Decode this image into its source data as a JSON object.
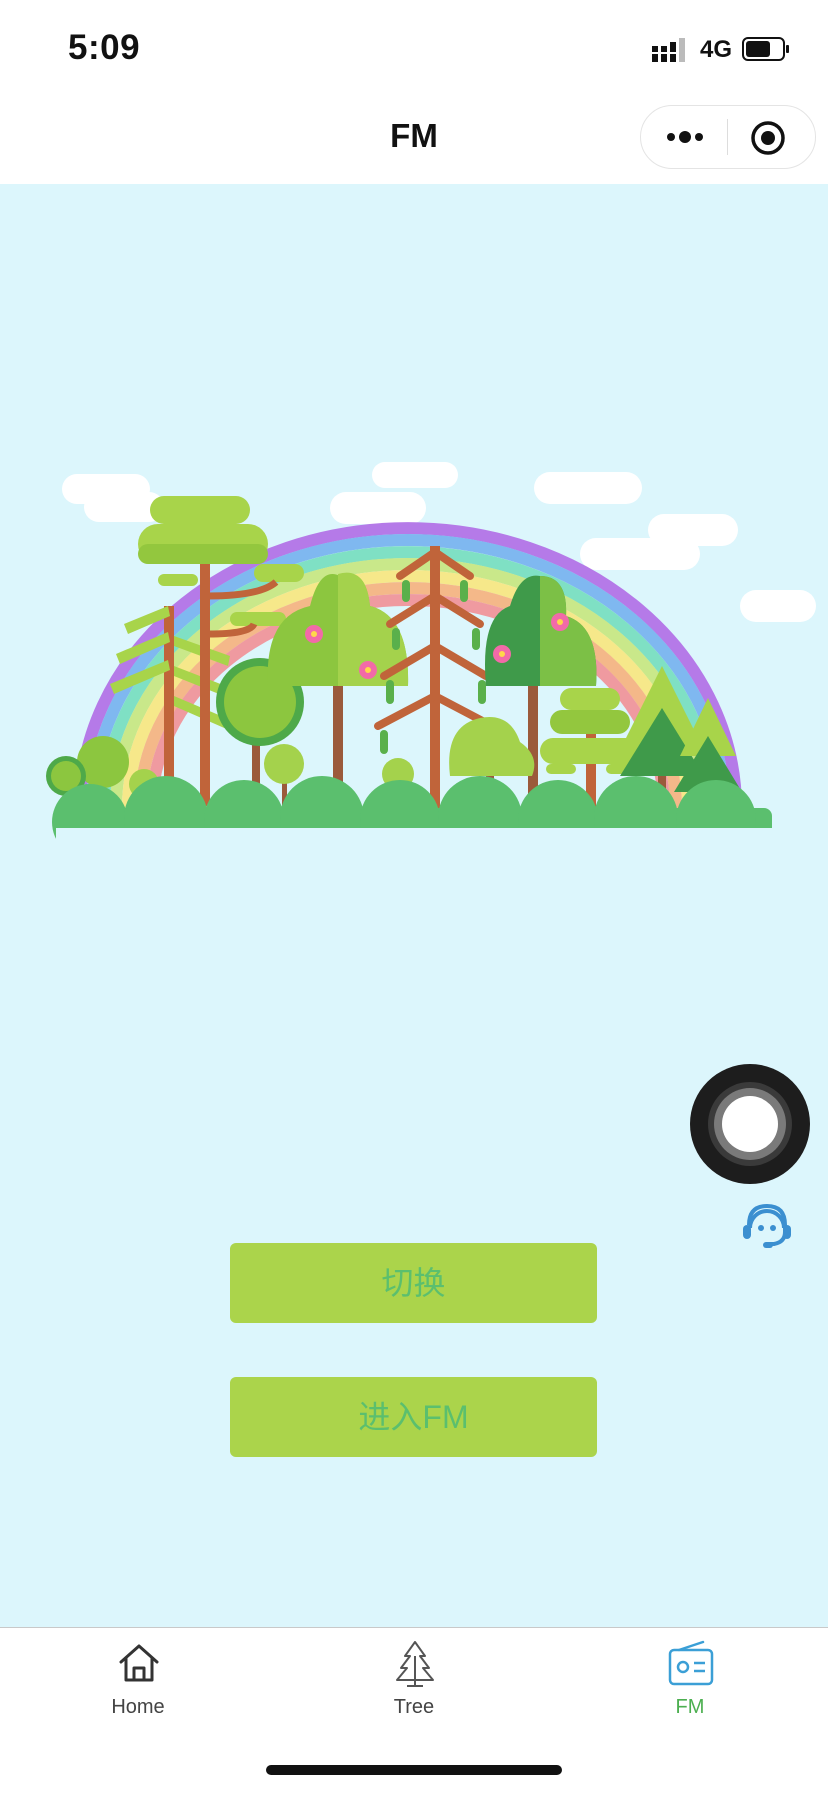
{
  "status_bar": {
    "time": "5:09",
    "network": "4G",
    "signal_icon": "signal-bars-icon",
    "battery_icon": "battery-icon"
  },
  "nav": {
    "title": "FM",
    "more_icon": "more-dots-icon",
    "close_icon": "target-circle-icon"
  },
  "main": {
    "background_color": "#dcf6fc",
    "illustration": "rainbow-forest-illustration",
    "float_icon": "record-disc-icon",
    "service_icon": "customer-service-icon",
    "buttons": {
      "switch_label": "切换",
      "enter_label": "进入FM"
    },
    "button_color": "#abd44b",
    "button_text_color": "#5bbf6e"
  },
  "tab_bar": {
    "active_color": "#4caf50",
    "tabs": [
      {
        "label": "Home",
        "icon": "home-icon"
      },
      {
        "label": "Tree",
        "icon": "tree-icon"
      },
      {
        "label": "FM",
        "icon": "radio-icon",
        "active": true
      }
    ]
  }
}
